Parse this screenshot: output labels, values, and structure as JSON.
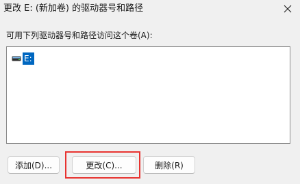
{
  "window": {
    "title": "更改 E: (新加卷) 的驱动器号和路径",
    "close_icon": "close-icon"
  },
  "prompt": "可用下列驱动器号和路径访问这个卷(A):",
  "list": {
    "items": [
      {
        "label": "E:",
        "icon": "drive-icon",
        "selected": true
      }
    ]
  },
  "buttons": {
    "add": "添加(D)...",
    "change": "更改(C)...",
    "remove": "删除(R)"
  },
  "annotation": {
    "highlight_color": "#e8322f",
    "highlighted_button": "change"
  },
  "colors": {
    "selection": "#0067c0",
    "background": "#f0f0f0"
  }
}
